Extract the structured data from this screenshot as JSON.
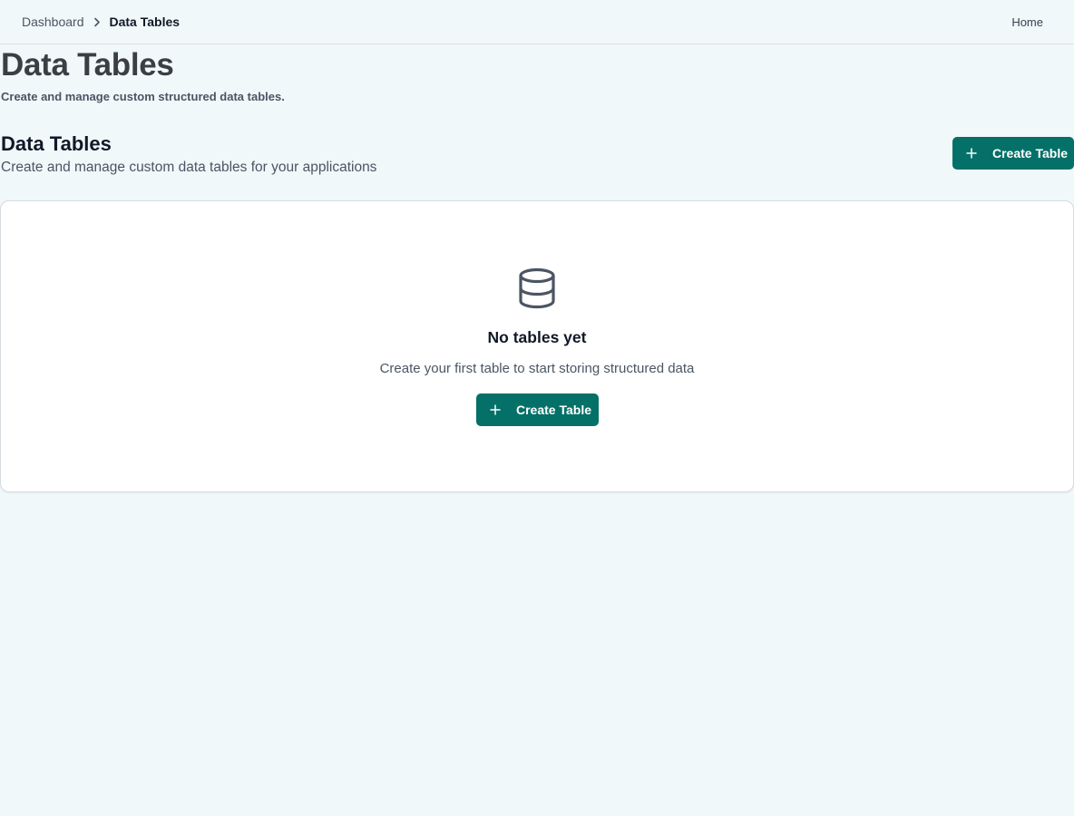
{
  "breadcrumb": {
    "parent": "Dashboard",
    "current": "Data Tables"
  },
  "topnav": {
    "home": "Home"
  },
  "page": {
    "title": "Data Tables",
    "subtitle": "Create and manage custom structured data tables."
  },
  "section": {
    "title": "Data Tables",
    "subtitle": "Create and manage custom data tables for your applications",
    "create_button": "Create Table"
  },
  "empty_state": {
    "icon": "database-icon",
    "title": "No tables yet",
    "text": "Create your first table to start storing structured data",
    "button": "Create Table"
  },
  "colors": {
    "accent": "#047068",
    "background": "#f1f8fa",
    "card": "#ffffff"
  }
}
